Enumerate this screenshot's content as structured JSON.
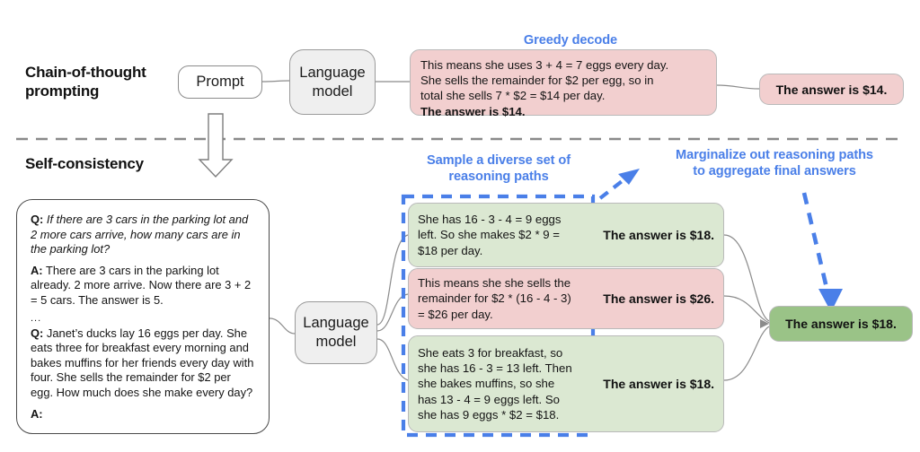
{
  "top": {
    "section_title": "Chain-of-thought\nprompting",
    "prompt_node": "Prompt",
    "model_node": "Language\nmodel",
    "decode_label": "Greedy decode",
    "output_box": {
      "reasoning": "This means she uses 3 + 4 = 7 eggs every day.\nShe sells the remainder for $2 per egg, so in\ntotal she sells 7 * $2 = $14 per day.",
      "answer_line": "The answer is $14.",
      "color": "#f2cfcf"
    },
    "final_answer": "The answer is $14."
  },
  "bottom": {
    "section_title": "Self-consistency",
    "model_node": "Language\nmodel",
    "sample_label": "Sample a diverse set of\nreasoning paths",
    "marginalize_label": "Marginalize out reasoning paths\nto aggregate final answers",
    "prompt_box": {
      "q1_label": "Q:",
      "q1_text": " If there are 3 cars in the parking lot and 2 more cars arrive, how many cars are in the parking lot?",
      "a1_label": "A:",
      "a1_text": " There are 3 cars in the parking lot already. 2 more arrive. Now there are 3 + 2 = 5 cars. The answer is 5.",
      "ellipsis": "...",
      "q2_label": "Q:",
      "q2_text": " Janet’s ducks lay 16 eggs per day. She eats three for breakfast every morning and bakes muffins for her friends every day with four. She sells the remainder for $2 per egg. How much does she make every day?",
      "a2_label": "A:"
    },
    "paths": [
      {
        "reasoning": "She has 16 - 3 - 4 = 9 eggs\nleft. So she makes $2 * 9 =\n$18 per day.",
        "answer": "The answer is $18.",
        "color": "#dbe8d2"
      },
      {
        "reasoning": "This means she she sells the\nremainder for $2 * (16 - 4 - 3)\n= $26 per day.",
        "answer": "The answer is $26.",
        "color": "#f2cfcf"
      },
      {
        "reasoning": "She eats 3 for breakfast, so\nshe has 16 - 3 = 13 left. Then\nshe bakes muffins, so she\nhas 13 - 4 = 9 eggs left. So\nshe has 9 eggs * $2 = $18.",
        "answer": "The answer is $18.",
        "color": "#dbe8d2"
      }
    ],
    "final_answer": "The answer is $18."
  },
  "colors": {
    "accent_blue": "#4a7fe8",
    "pink": "#f2cfcf",
    "light_green": "#dbe8d2",
    "dark_green": "#9ac387",
    "gray_node": "#efefef",
    "divider": "#8a8a8a"
  }
}
